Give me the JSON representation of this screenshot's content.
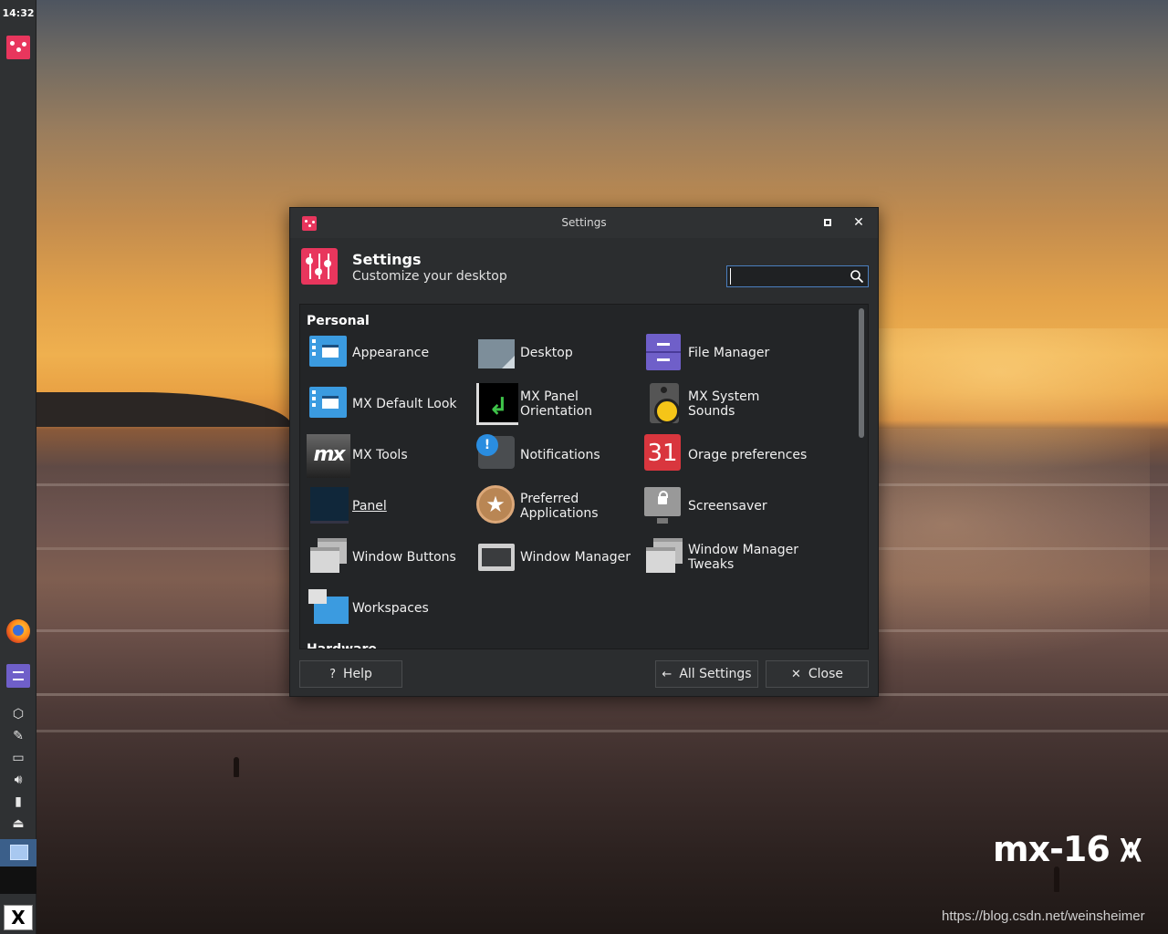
{
  "panel": {
    "clock": "14:32"
  },
  "window": {
    "title": "Settings",
    "header": {
      "title": "Settings",
      "subtitle": "Customize your desktop"
    },
    "search": {
      "value": "",
      "placeholder": ""
    },
    "sections": [
      {
        "title": "Personal",
        "items": [
          {
            "label": "Appearance",
            "icon": "appearance-icon"
          },
          {
            "label": "Desktop",
            "icon": "desktop-icon"
          },
          {
            "label": "File Manager",
            "icon": "file-manager-icon"
          },
          {
            "label": "MX Default Look",
            "icon": "mx-default-look-icon"
          },
          {
            "label": "MX Panel\nOrientation",
            "icon": "mx-panel-orientation-icon"
          },
          {
            "label": "MX System Sounds",
            "icon": "speaker-icon"
          },
          {
            "label": "MX Tools",
            "icon": "mx-tools-icon"
          },
          {
            "label": "Notifications",
            "icon": "notifications-icon"
          },
          {
            "label": "Orage preferences",
            "icon": "calendar-icon"
          },
          {
            "label": "Panel",
            "icon": "panel-icon"
          },
          {
            "label": "Preferred\nApplications",
            "icon": "preferred-applications-icon"
          },
          {
            "label": "Screensaver",
            "icon": "screensaver-icon"
          },
          {
            "label": "Window Buttons",
            "icon": "window-buttons-icon"
          },
          {
            "label": "Window Manager",
            "icon": "window-manager-icon"
          },
          {
            "label": "Window Manager\nTweaks",
            "icon": "window-manager-tweaks-icon"
          },
          {
            "label": "Workspaces",
            "icon": "workspaces-icon"
          }
        ]
      },
      {
        "title": "Hardware",
        "items": []
      }
    ],
    "calendar_day": "31",
    "buttons": {
      "help": "Help",
      "all_settings": "All Settings",
      "close": "Close"
    }
  },
  "desktop": {
    "logo": "mx-16",
    "watermark": "https://blog.csdn.net/weinsheimer"
  },
  "colors": {
    "accent": "#e8365d",
    "focus": "#4b7fbf",
    "window_bg": "#2b2d2f"
  }
}
